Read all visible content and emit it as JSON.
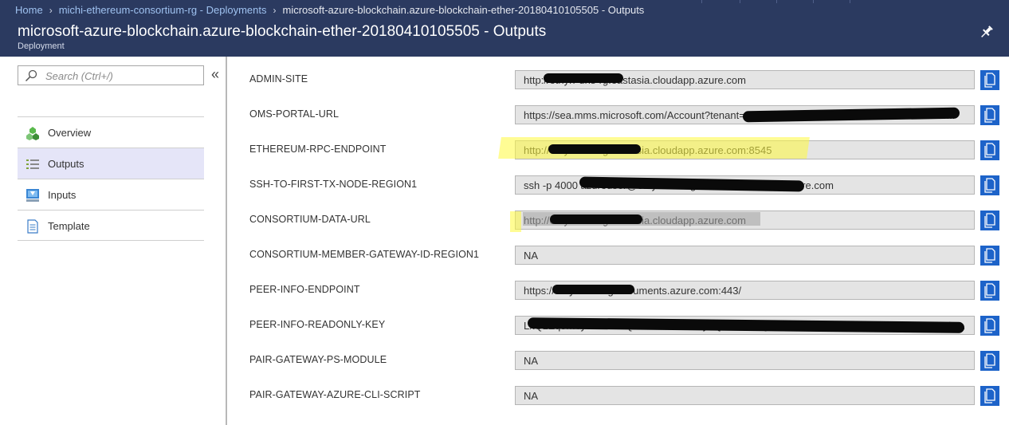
{
  "breadcrumb": {
    "home": "Home",
    "parent": "michi-ethereum-consortium-rg - Deployments",
    "current": "microsoft-azure-blockchain.azure-blockchain-ether-20180410105505 - Outputs"
  },
  "header": {
    "title": "microsoft-azure-blockchain.azure-blockchain-ether-20180410105505 - Outputs",
    "subtitle": "Deployment"
  },
  "search": {
    "placeholder": "Search (Ctrl+/)",
    "value": ""
  },
  "menu": {
    "collapse_glyph": "«",
    "items": [
      {
        "label": "Overview",
        "icon": "overview-icon",
        "active": false
      },
      {
        "label": "Outputs",
        "icon": "outputs-icon",
        "active": true
      },
      {
        "label": "Inputs",
        "icon": "inputs-icon",
        "active": false
      },
      {
        "label": "Template",
        "icon": "template-icon",
        "active": false
      }
    ]
  },
  "outputs": [
    {
      "key": "ADMIN-SITE",
      "value": "http://ethyrf-dns-rg.eastasia.cloudapp.azure.com"
    },
    {
      "key": "OMS-PORTAL-URL",
      "value": "https://sea.mms.microsoft.com/Account?tenant=73f988bf-86f1-41af-91ab-2d7cd011db47&re..."
    },
    {
      "key": "ETHEREUM-RPC-ENDPOINT",
      "value": "http://ethyrf-dns-rg.eastasia.cloudapp.azure.com:8545"
    },
    {
      "key": "SSH-TO-FIRST-TX-NODE-REGION1",
      "value": "ssh -p 4000 azureuser@ethyrf-dns-rg.eastasia.cloudapp.azure.com"
    },
    {
      "key": "CONSORTIUM-DATA-URL",
      "value": "http://ethyrf-dns-rg.eastasia.cloudapp.azure.com"
    },
    {
      "key": "CONSORTIUM-MEMBER-GATEWAY-ID-REGION1",
      "value": "NA"
    },
    {
      "key": "PEER-INFO-ENDPOINT",
      "value": "https://ethyrf-dns-rg.documents.azure.com:443/"
    },
    {
      "key": "PEER-INFO-READONLY-KEY",
      "value": "LxQ2Zq8mTyeHtU7fBQ5LxPhXnWHrYyIfQc8lJdOhQww5UftnzSd17dDwepHdjc71e57Cllbt4du..."
    },
    {
      "key": "PAIR-GATEWAY-PS-MODULE",
      "value": "NA"
    },
    {
      "key": "PAIR-GATEWAY-AZURE-CLI-SCRIPT",
      "value": "NA"
    }
  ],
  "colors": {
    "header_bg": "#2b3a60",
    "copy_button": "#1d63c9",
    "active_menu_bg": "#e5e5f8",
    "highlight": "#fffa3c"
  }
}
